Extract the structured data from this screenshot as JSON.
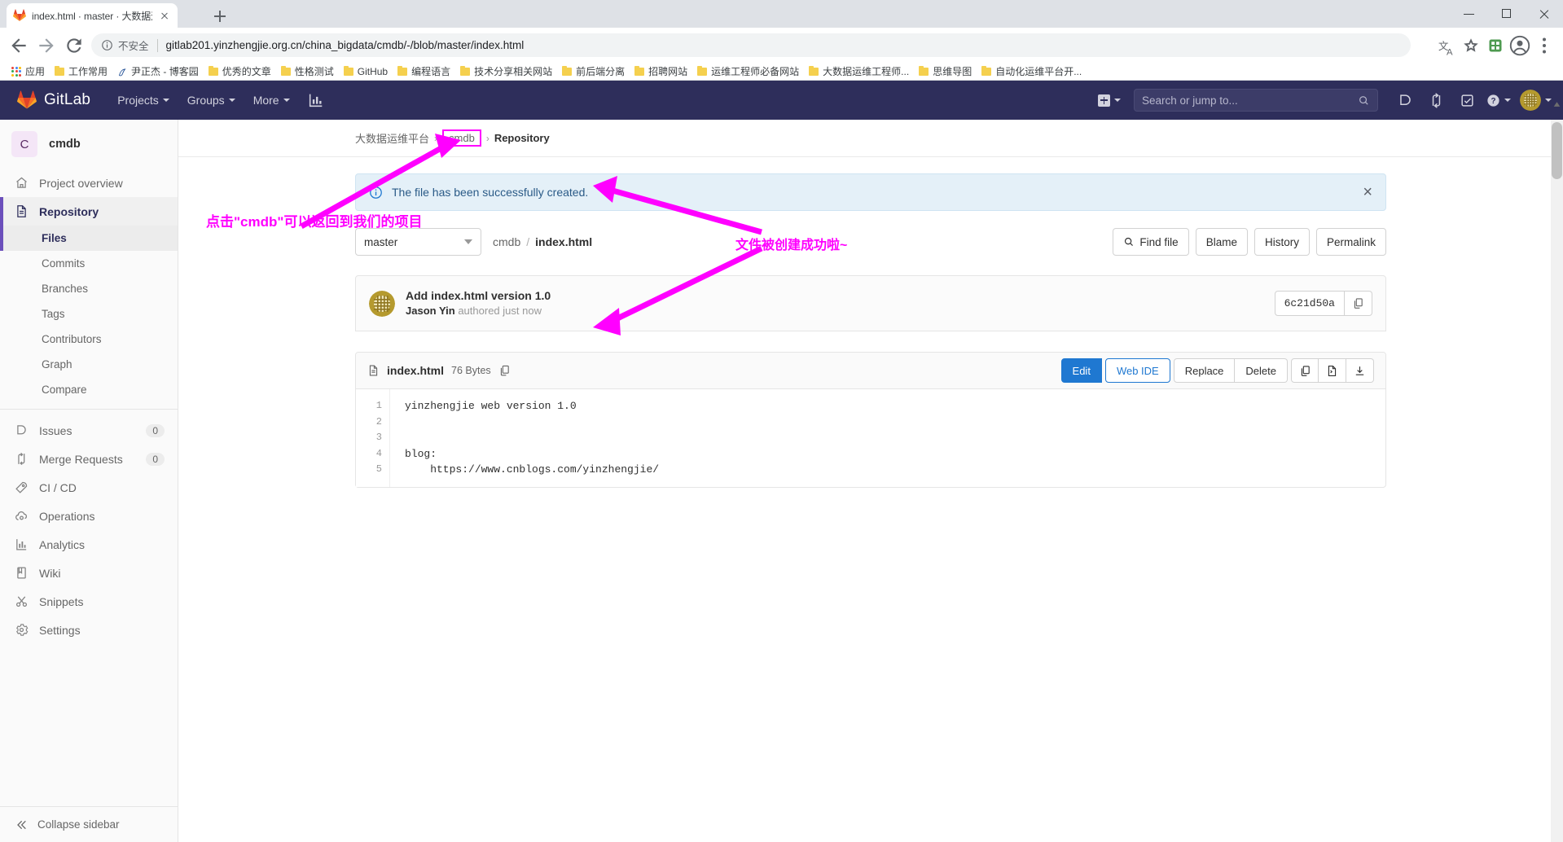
{
  "browser": {
    "tab": {
      "title": "index.html · master · 大数据运维",
      "favicon": "gitlab-favicon"
    },
    "newtab_label": "+",
    "omnibox": {
      "security_label": "不安全",
      "url": "gitlab201.yinzhengjie.org.cn/china_bigdata/cmdb/-/blob/master/index.html"
    },
    "bookmarks": [
      {
        "label": "应用",
        "icon": "apps-grid-icon"
      },
      {
        "label": "工作常用",
        "icon": "folder-icon"
      },
      {
        "label": "尹正杰 - 博客园",
        "icon": "cnblogs-icon"
      },
      {
        "label": "优秀的文章",
        "icon": "folder-icon"
      },
      {
        "label": "性格测试",
        "icon": "folder-icon"
      },
      {
        "label": "GitHub",
        "icon": "folder-icon"
      },
      {
        "label": "编程语言",
        "icon": "folder-icon"
      },
      {
        "label": "技术分享相关网站",
        "icon": "folder-icon"
      },
      {
        "label": "前后端分离",
        "icon": "folder-icon"
      },
      {
        "label": "招聘网站",
        "icon": "folder-icon"
      },
      {
        "label": "运维工程师必备网站",
        "icon": "folder-icon"
      },
      {
        "label": "大数据运维工程师...",
        "icon": "folder-icon"
      },
      {
        "label": "思维导图",
        "icon": "folder-icon"
      },
      {
        "label": "自动化运维平台开...",
        "icon": "folder-icon"
      }
    ]
  },
  "gitlab_nav": {
    "brand": "GitLab",
    "menu": [
      {
        "label": "Projects",
        "caret": true
      },
      {
        "label": "Groups",
        "caret": true
      },
      {
        "label": "More",
        "caret": true
      }
    ],
    "chart_icon": "analytics-icon",
    "plus_icon": "new-item-icon",
    "search_placeholder": "Search or jump to...",
    "icons": [
      "issues-icon",
      "merge-requests-icon",
      "todos-icon",
      "help-icon"
    ],
    "avatar": "user-avatar"
  },
  "sidebar": {
    "project": {
      "initial": "C",
      "name": "cmdb"
    },
    "items": [
      {
        "label": "Project overview",
        "icon": "home-icon",
        "active": false,
        "badge": null
      },
      {
        "label": "Repository",
        "icon": "document-icon",
        "active": true,
        "badge": null
      }
    ],
    "repository_subitems": [
      {
        "label": "Files",
        "current": true
      },
      {
        "label": "Commits",
        "current": false
      },
      {
        "label": "Branches",
        "current": false
      },
      {
        "label": "Tags",
        "current": false
      },
      {
        "label": "Contributors",
        "current": false
      },
      {
        "label": "Graph",
        "current": false
      },
      {
        "label": "Compare",
        "current": false
      }
    ],
    "items2": [
      {
        "label": "Issues",
        "icon": "issues-icon",
        "badge": "0"
      },
      {
        "label": "Merge Requests",
        "icon": "merge-requests-icon",
        "badge": "0"
      },
      {
        "label": "CI / CD",
        "icon": "rocket-icon",
        "badge": null
      },
      {
        "label": "Operations",
        "icon": "cloud-gear-icon",
        "badge": null
      },
      {
        "label": "Analytics",
        "icon": "chart-icon",
        "badge": null
      },
      {
        "label": "Wiki",
        "icon": "book-icon",
        "badge": null
      },
      {
        "label": "Snippets",
        "icon": "scissors-icon",
        "badge": null
      },
      {
        "label": "Settings",
        "icon": "gear-icon",
        "badge": null
      }
    ],
    "collapse_label": "Collapse sidebar",
    "collapse_icon": "collapse-icon"
  },
  "breadcrumb": {
    "group": "大数据运维平台",
    "project": "cmdb",
    "section": "Repository",
    "separator": "›"
  },
  "alert": {
    "icon": "info-icon",
    "message": "The file has been successfully created.",
    "close": "×"
  },
  "file_toolbar": {
    "branch": "master",
    "path_segments": [
      "cmdb"
    ],
    "path_separator": "/",
    "file_name": "index.html",
    "buttons": [
      {
        "label": "Find file",
        "icon": "search-icon"
      },
      {
        "label": "Blame",
        "icon": null
      },
      {
        "label": "History",
        "icon": null
      },
      {
        "label": "Permalink",
        "icon": null
      }
    ]
  },
  "commit": {
    "title": "Add index.html version 1.0",
    "author": "Jason Yin",
    "meta": "authored just now",
    "sha": "6c21d50a",
    "copy_icon": "copy-icon"
  },
  "file_card": {
    "icon": "file-icon",
    "name": "index.html",
    "size": "76 Bytes",
    "copy_icon": "copy-path-icon",
    "actions": {
      "edit": "Edit",
      "web_ide": "Web IDE",
      "replace": "Replace",
      "delete": "Delete"
    },
    "icon_actions": [
      "copy-contents-icon",
      "open-raw-icon",
      "download-icon"
    ],
    "lines": [
      "1",
      "2",
      "3",
      "4",
      "5"
    ],
    "code": [
      "yinzhengjie web version 1.0",
      "",
      "",
      "blog:",
      "    https://www.cnblogs.com/yinzhengjie/"
    ]
  },
  "annotations": [
    {
      "id": "anno1",
      "text": "点击\"cmdb\"可以返回到我们的项目",
      "color": "#ff00ff"
    },
    {
      "id": "anno2",
      "text": "文件被创建成功啦~",
      "color": "#ff00ff"
    }
  ]
}
